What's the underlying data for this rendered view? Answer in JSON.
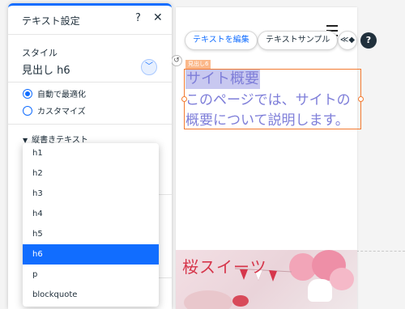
{
  "panel": {
    "title": "テキスト設定",
    "help_label": "?",
    "close_label": "✕",
    "style_label": "スタイル",
    "style_value": "見出し h6",
    "radio_auto": "自動で最適化",
    "radio_custom": "カスタマイズ",
    "vertical_label": "縦書きテキスト"
  },
  "dropdown": {
    "items": [
      "h1",
      "h2",
      "h3",
      "h4",
      "h5",
      "h6",
      "p",
      "blockquote"
    ],
    "selected": "h6"
  },
  "toolbar": {
    "edit_label": "テキストを編集",
    "sample_label": "テキストサンプル",
    "help_label": "?"
  },
  "canvas": {
    "tag_label": "見出し6",
    "heading": "サイト概要",
    "paragraph": "このページでは、サイトの概要について説明します。",
    "hero_title": "桜スイーツ"
  },
  "colors": {
    "accent": "#116dff",
    "selection": "#f37a30",
    "text_purple": "#7e7ed9",
    "hero_red": "#d6364b"
  },
  "icons": [
    "help-icon",
    "close-icon",
    "chevron-down-icon",
    "hamburger-icon",
    "animation-icon",
    "rotate-icon",
    "caret-down-icon"
  ]
}
